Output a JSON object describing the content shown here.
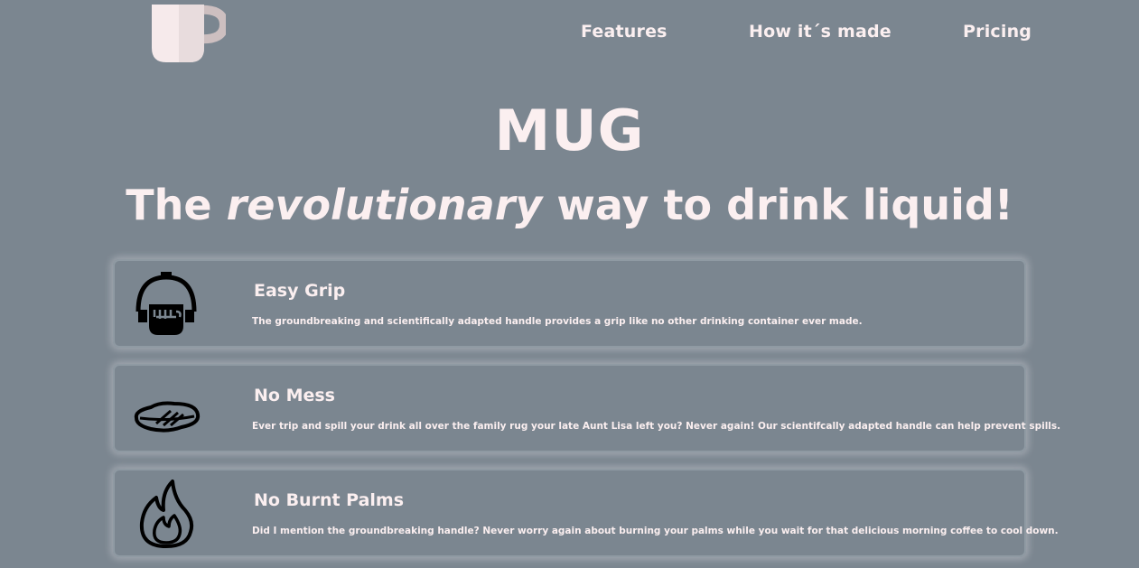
{
  "header": {
    "logo_icon": "mug-icon",
    "nav": [
      {
        "label": "Features"
      },
      {
        "label": "How it´s made"
      },
      {
        "label": "Pricing"
      }
    ]
  },
  "hero": {
    "title": "MUG",
    "tagline_start": "The ",
    "tagline_emphasis": "revolutionary",
    "tagline_end": " way to drink liquid!"
  },
  "features": [
    {
      "icon": "hand-grip-icon",
      "title": "Easy Grip",
      "description": "The groundbreaking and scientifically adapted handle provides a grip like no other drinking container ever made."
    },
    {
      "icon": "spill-puddle-icon",
      "title": "No Mess",
      "description": "Ever trip and spill your drink all over the family rug your late Aunt Lisa left you? Never again! Our scientifcally adapted handle can help prevent spills."
    },
    {
      "icon": "flame-icon",
      "title": "No Burnt Palms",
      "description": "Did I mention the groundbreaking handle? Never worry again about burning your palms while you wait for that delicious morning coffee to cool down."
    }
  ],
  "colors": {
    "background": "#7b8690",
    "text": "#fbeff0",
    "card_border": "#8f9aa3",
    "icon_stroke": "#000000"
  }
}
